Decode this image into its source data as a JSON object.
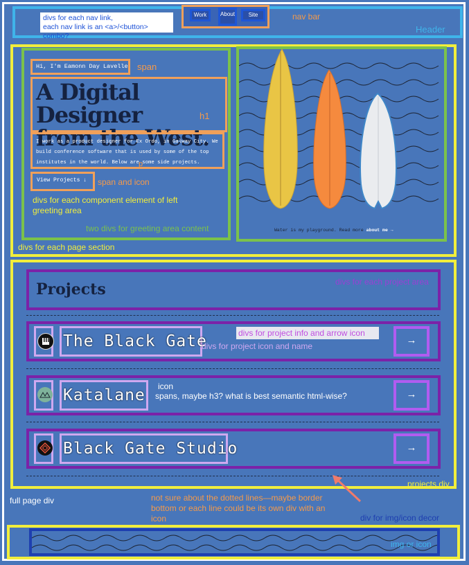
{
  "header": {
    "nav": [
      {
        "label": "Work"
      },
      {
        "label": "About"
      },
      {
        "label": "Site"
      }
    ],
    "note": [
      "divs for each nav link,",
      "each nav link is an <a>/<button> combo?"
    ]
  },
  "greeting": {
    "intro": "Hi, I'm Eamonn Day Lavelle",
    "title_line1": "A Digital Designer",
    "title_line2": "from the West.",
    "body": "I work as a product designer for Ex Ordo, in Galway City. We build conference software that is used by some of the top institutes in the world. Below are some side projects.",
    "cta": "View Projects ↓",
    "caption_prefix": "Water is my playground. Read more",
    "caption_link": "about me →"
  },
  "projects": {
    "heading": "Projects",
    "items": [
      {
        "name": "The Black Gate",
        "icon": "piano-icon"
      },
      {
        "name": "Katalane",
        "icon": "mountain-icon"
      },
      {
        "name": "Black Gate Studio",
        "icon": "diamond-icon"
      }
    ],
    "arrow": "→"
  },
  "annotations": {
    "nav_bar": "nav bar",
    "header": "Header",
    "span": "span",
    "h1": "h1",
    "p": "p",
    "span_icon": "span and icon",
    "left_divs": [
      "divs for each component element of left",
      "greeting area"
    ],
    "two_divs": "two divs for greeting area content",
    "page_section": "divs for each page section",
    "project_area": "divs for each project area",
    "project_info": "divs for project info and arrow icon",
    "project_icon_name": "divs for project icon and name",
    "icon": "icon",
    "spans_h3": "spans, maybe h3? what is best semantic html-wise?",
    "projects_div": "projects div",
    "full_page": "full page div",
    "dotted": [
      "not sure about the dotted lines—maybe border",
      "bottom or each line could be its own div with an",
      "icon"
    ],
    "decor_div": "div for img/icon decor",
    "img_icon": "img or icon"
  },
  "colors": {
    "background": "#4876ba",
    "header_frame": "#3fb4ea",
    "section_frame": "#f1ee3c",
    "content_frame": "#7bc24b",
    "element_frame": "#f0a05a",
    "project_frame": "#7b22a8",
    "orange_annotation": "#f59a4a",
    "arrow_accent": "#f07b6b"
  }
}
